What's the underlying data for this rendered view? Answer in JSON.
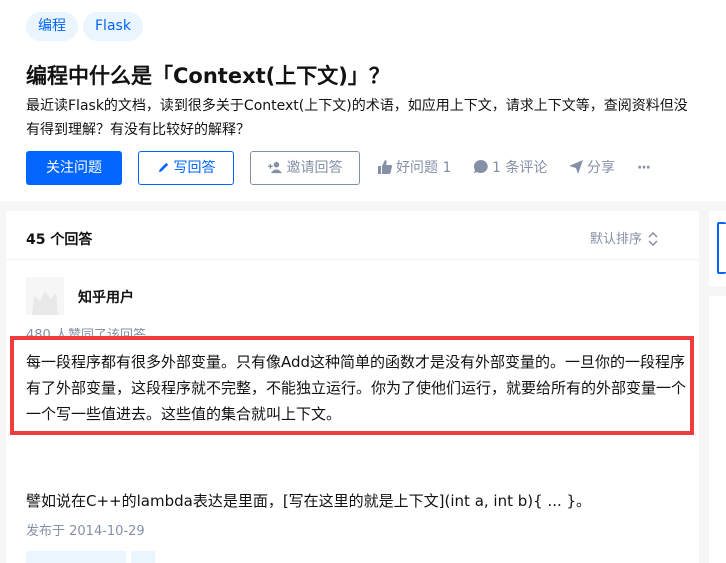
{
  "topics": [
    "编程",
    "Flask"
  ],
  "question": {
    "title": "编程中什么是「Context(上下文)」？",
    "description": "最近读Flask的文档，读到很多关于Context(上下文)的术语，如应用上下文，请求上下文等，查阅资料但没有得到理解？有没有比较好的解释？"
  },
  "actions": {
    "follow": "关注问题",
    "write": "写回答",
    "invite": "邀请回答",
    "good_question": "好问题 1",
    "comments": "1 条评论",
    "share": "分享",
    "more": "···"
  },
  "answers_header": {
    "count": "45 个回答",
    "sort": "默认排序"
  },
  "answer": {
    "author": "知乎用户",
    "likes": "480 人赞同了该回答",
    "paragraph1": "每一段程序都有很多外部变量。只有像Add这种简单的函数才是没有外部变量的。一旦你的一段程序有了外部变量，这段程序就不完整，不能独立运行。你为了使他们运行，就要给所有的外部变量一个一个写一些值进去。这些值的集合就叫上下文。",
    "paragraph2": "譬如说在C++的lambda表达是里面，[写在这里的就是上下文](int a, int b){ ... }。",
    "date": "发布于 2014-10-29"
  },
  "colors": {
    "brand": "#0066ff",
    "muted": "#8590a6",
    "highlight_border": "#f03c3c"
  }
}
